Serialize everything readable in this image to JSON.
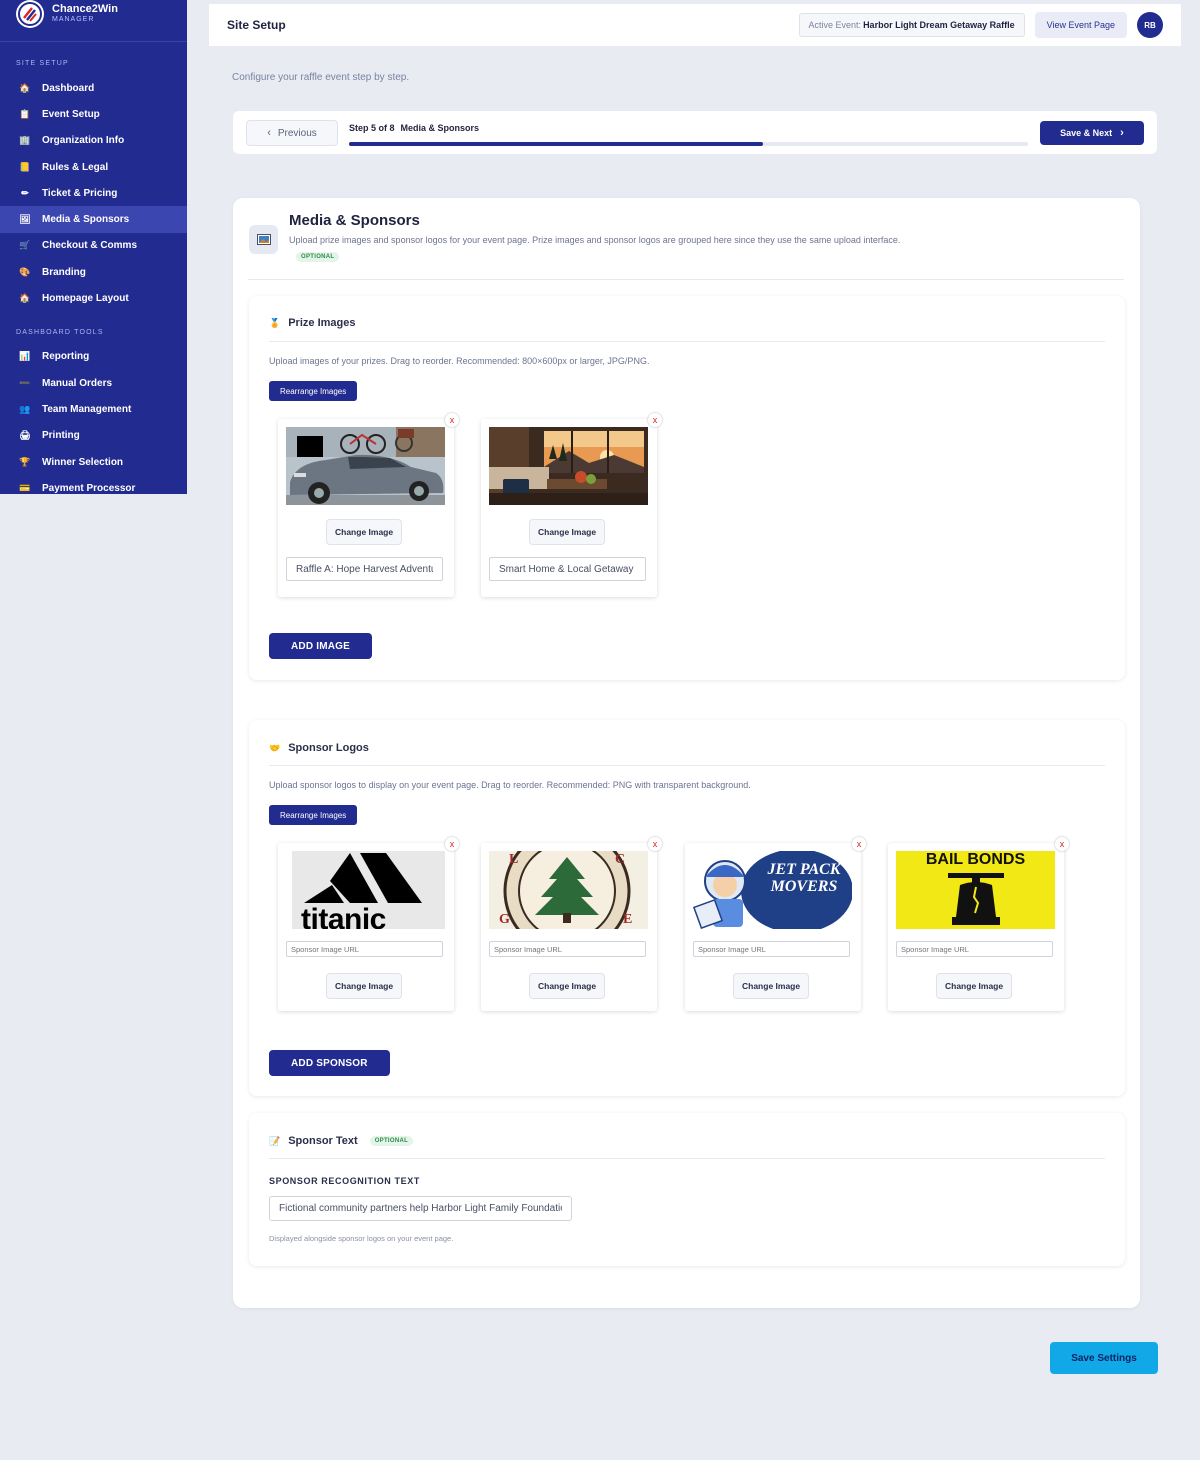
{
  "brand": {
    "name": "Chance2Win",
    "sub": "MANAGER",
    "logo_icon": "chance2win-logo"
  },
  "sidebar": {
    "section1": "SITE SETUP",
    "items1": [
      {
        "label": "Dashboard",
        "icon": "home-icon"
      },
      {
        "label": "Event Setup",
        "icon": "clipboard-icon"
      },
      {
        "label": "Organization Info",
        "icon": "building-icon"
      },
      {
        "label": "Rules & Legal",
        "icon": "book-icon"
      },
      {
        "label": "Ticket & Pricing",
        "icon": "ticket-icon"
      },
      {
        "label": "Media & Sponsors",
        "icon": "image-icon"
      },
      {
        "label": "Checkout & Comms",
        "icon": "cart-icon"
      },
      {
        "label": "Branding",
        "icon": "palette-icon"
      },
      {
        "label": "Homepage Layout",
        "icon": "home-layout-icon"
      }
    ],
    "section2": "DASHBOARD TOOLS",
    "items2": [
      {
        "label": "Reporting",
        "icon": "chart-icon"
      },
      {
        "label": "Manual Orders",
        "icon": "pen-icon"
      },
      {
        "label": "Team Management",
        "icon": "team-icon"
      },
      {
        "label": "Printing",
        "icon": "printer-icon"
      },
      {
        "label": "Winner Selection",
        "icon": "trophy-icon"
      },
      {
        "label": "Payment Processor",
        "icon": "card-icon"
      }
    ]
  },
  "header": {
    "title": "Site Setup",
    "active_event_label": "Active Event:",
    "active_event_name": "Harbor Light Dream Getaway Raffle",
    "view_button": "View Event Page",
    "avatar_initials": "RB"
  },
  "subtitle": "Configure your raffle event step by step.",
  "stepper": {
    "previous_label": "Previous",
    "step_text": "Step 5 of 8",
    "step_name": "Media & Sponsors",
    "progress": 0.61,
    "next_label": "Save & Next"
  },
  "main": {
    "title": "Media & Sponsors",
    "description": "Upload prize images and sponsor logos for your event page. Prize images and sponsor logos are grouped here since they use the same upload interface.",
    "badge": "OPTIONAL"
  },
  "prize_images": {
    "title": "Prize Images",
    "description": "Upload images of your prizes. Drag to reorder. Recommended: 800×600px or larger, JPG/PNG.",
    "rearrange_label": "Rearrange Images",
    "remove_label": "x",
    "change_label": "Change Image",
    "tiles": [
      {
        "caption": "Raffle A: Hope Harvest Adventure",
        "image": "car-and-bikes-photo"
      },
      {
        "caption": "Smart Home & Local Getaway",
        "image": "cozy-living-room-photo"
      }
    ],
    "add_label": "ADD IMAGE"
  },
  "sponsor_logos": {
    "title": "Sponsor Logos",
    "description": "Upload sponsor logos to display on your event page. Drag to reorder. Recommended: PNG with transparent background.",
    "rearrange_label": "Rearrange Images",
    "remove_label": "x",
    "url_placeholder": "Sponsor Image URL",
    "change_label": "Change Image",
    "tiles": [
      {
        "image": "titanic-logo",
        "logo_text": "titanic"
      },
      {
        "image": "green-tree-seal-logo",
        "logo_text": ""
      },
      {
        "image": "jetpack-movers-logo",
        "logo_text": "JET PACK MOVERS"
      },
      {
        "image": "bail-bonds-logo",
        "logo_text": "BAIL BONDS"
      }
    ],
    "add_label": "ADD SPONSOR"
  },
  "sponsor_text": {
    "title": "Sponsor Text",
    "badge": "OPTIONAL",
    "field_label": "SPONSOR RECOGNITION TEXT",
    "field_value": "Fictional community partners help Harbor Light Family Foundation",
    "hint": "Displayed alongside sponsor logos on your event page."
  },
  "save_settings": "Save Settings",
  "colors": {
    "primary": "#222b8f",
    "accent": "#10a8e6",
    "danger": "#dd2222"
  }
}
